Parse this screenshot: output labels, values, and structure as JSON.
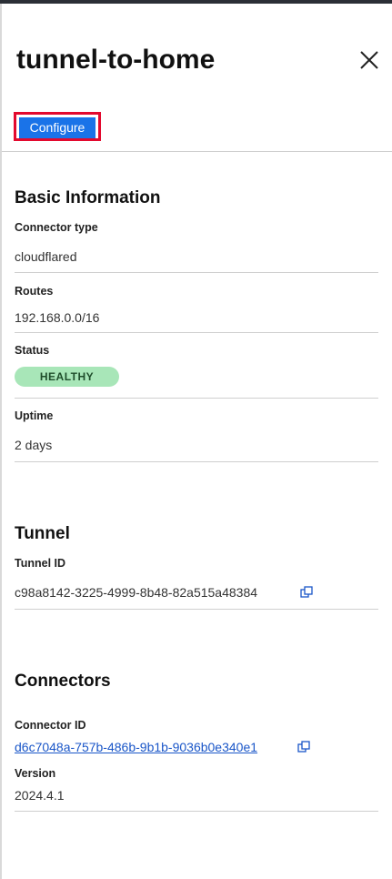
{
  "header": {
    "title": "tunnel-to-home",
    "configure_label": "Configure"
  },
  "basic_information": {
    "heading": "Basic Information",
    "connector_type_label": "Connector type",
    "connector_type_value": "cloudflared",
    "routes_label": "Routes",
    "routes_value": "192.168.0.0/16",
    "status_label": "Status",
    "status_value": "HEALTHY",
    "uptime_label": "Uptime",
    "uptime_value": "2 days"
  },
  "tunnel": {
    "heading": "Tunnel",
    "tunnel_id_label": "Tunnel ID",
    "tunnel_id_value": "c98a8142-3225-4999-8b48-82a515a48384"
  },
  "connectors": {
    "heading": "Connectors",
    "connector_id_label": "Connector ID",
    "connector_id_value": "d6c7048a-757b-486b-9b1b-9036b0e340e1",
    "version_label": "Version",
    "version_value": "2024.4.1"
  },
  "colors": {
    "accent": "#1a73e8",
    "highlight_border": "#e3092e",
    "status_healthy": "#a8e6b8",
    "link": "#1a56c8"
  },
  "icons": {
    "close": "close-icon",
    "copy": "copy-icon"
  }
}
